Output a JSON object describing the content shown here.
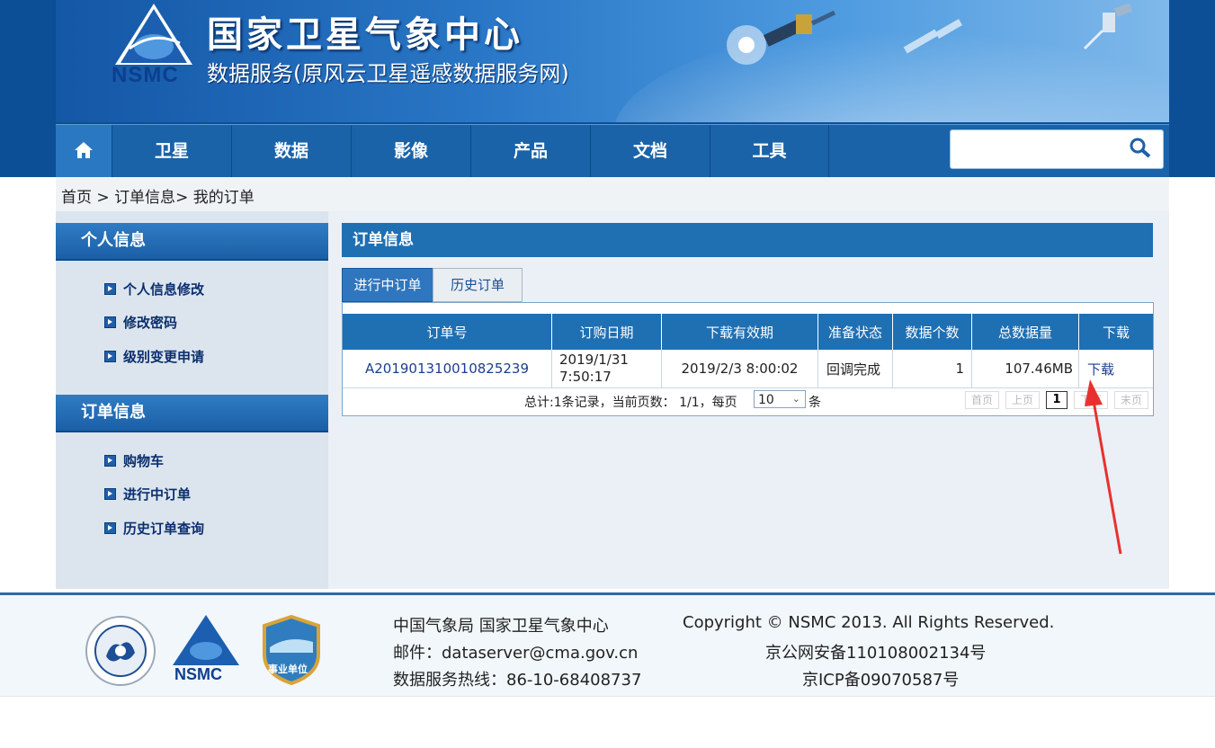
{
  "header": {
    "site_title": "国家卫星气象中心",
    "site_subtitle": "数据服务(原风云卫星遥感数据服务网)",
    "logo_text": "NSMC"
  },
  "nav": {
    "items": [
      "卫星",
      "数据",
      "影像",
      "产品",
      "文档",
      "工具"
    ],
    "search_placeholder": ""
  },
  "breadcrumb": {
    "home": "首页",
    "sep1": " > ",
    "section": "订单信息",
    "sep2": "> ",
    "current": "我的订单"
  },
  "sidebar": {
    "personal_title": "个人信息",
    "personal_items": [
      "个人信息修改",
      "修改密码",
      "级别变更申请"
    ],
    "order_title": "订单信息",
    "order_items": [
      "购物车",
      "进行中订单",
      "历史订单查询"
    ]
  },
  "content": {
    "title": "订单信息",
    "tab_active": "进行中订单",
    "tab_history": "历史订单",
    "columns": [
      "订单号",
      "订购日期",
      "下载有效期",
      "准备状态",
      "数据个数",
      "总数据量",
      "下载"
    ],
    "rows": [
      {
        "order_no": "A201901310010825239",
        "order_date_line1": "2019/1/31",
        "order_date_line2": "7:50:17",
        "expiry": "2019/2/3 8:00:02",
        "status": "回调完成",
        "count": "1",
        "size": "107.46MB",
        "download": "下载"
      }
    ],
    "pager_text": "总计:1条记录，当前页数： 1/1，每页",
    "page_size": "10",
    "pager_unit": "条",
    "pager_buttons": [
      "首页",
      "上页",
      "1",
      "下页",
      "末页"
    ]
  },
  "footer": {
    "org": "中国气象局 国家卫星气象中心",
    "email": "邮件：dataserver@cma.gov.cn",
    "hotline": "数据服务热线：86-10-68408737",
    "copyright": "Copyright © NSMC 2013. All Rights Reserved.",
    "beian1": "京公网安备110108002134号",
    "beian2": "京ICP备09070587号",
    "logo_nsmc": "NSMC",
    "badge_text": "事业单位"
  },
  "colors": {
    "nav_blue": "#1a63a8",
    "header_blue": "#1f6fb3",
    "annotation_red": "#e8312f"
  }
}
